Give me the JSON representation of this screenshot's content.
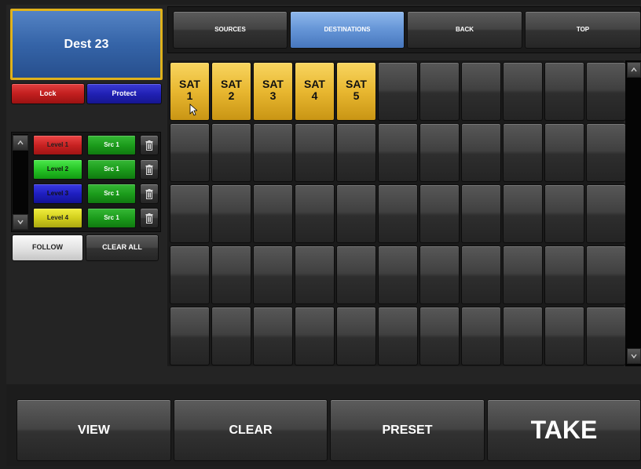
{
  "destination": {
    "name": "Dest 23"
  },
  "buttons": {
    "lock": "Lock",
    "protect": "Protect",
    "follow": "FOLLOW",
    "clear_all": "CLEAR ALL"
  },
  "levels": [
    {
      "label": "Level 1",
      "source": "Src 1",
      "color": "#c82222"
    },
    {
      "label": "Level 2",
      "source": "Src 1",
      "color": "#26c426"
    },
    {
      "label": "Level 3",
      "source": "Src 1",
      "color": "#1f1fc0"
    },
    {
      "label": "Level 4",
      "source": "Src 1",
      "color": "#d2cf1c"
    }
  ],
  "nav": {
    "sources": "SOURCES",
    "destinations": "DESTINATIONS",
    "back": "BACK",
    "top": "TOP",
    "active": "DESTINATIONS"
  },
  "grid": {
    "rows": 5,
    "cols": 11,
    "cells": [
      {
        "line1": "SAT",
        "line2": "1"
      },
      {
        "line1": "SAT",
        "line2": "2"
      },
      {
        "line1": "SAT",
        "line2": "3"
      },
      {
        "line1": "SAT",
        "line2": "4"
      },
      {
        "line1": "SAT",
        "line2": "5"
      }
    ]
  },
  "bottom": {
    "view": "VIEW",
    "clear": "CLEAR",
    "preset": "PRESET",
    "take": "TAKE"
  },
  "icons": {
    "scroll_up": "chevron-up-icon",
    "scroll_down": "chevron-down-icon",
    "trash": "trash-icon",
    "cursor": "mouse-pointer-icon"
  },
  "colors": {
    "accent_selected": "#e0b21b",
    "dest_blue": "#3564a8",
    "nav_active": "#6494d6",
    "sat_gold": "#e8b730"
  }
}
